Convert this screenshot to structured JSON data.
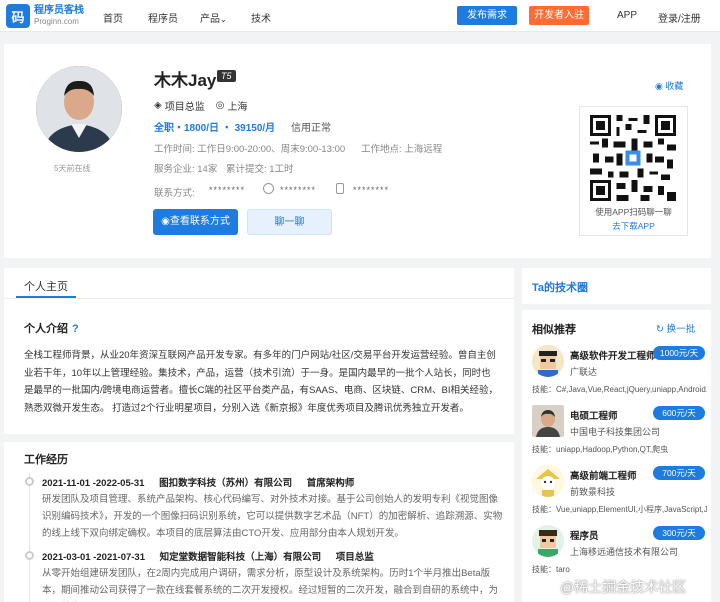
{
  "nav": {
    "logo_mark": "码",
    "logo_cn": "程序员客栈",
    "logo_en": "Proginn.com",
    "items": [
      "首页",
      "程序员",
      "产品",
      "技术"
    ],
    "post_button": "发布需求",
    "join_button": "开发者入驻",
    "app": "APP",
    "login": "登录/注册"
  },
  "profile": {
    "name": "木木Jay",
    "badge": "T5",
    "title": "项目总监",
    "city": "上海",
    "rate": "全职・1800/日 ・ 39150/月",
    "credit": "信用正常",
    "avatar_caption": "5天前在线",
    "work_time": "工作时间: 工作日9:00-20:00、周末9:00-13:00",
    "work_place": "工作地点: 上海远程",
    "service": "服务企业: 14家",
    "submits": "累计提交: 1工时",
    "contact_label": "联系方式:",
    "masked1": "********",
    "masked2": "********",
    "masked3": "********",
    "contact_button": "查看联系方式",
    "chat_button": "聊一聊",
    "favorite": "收藏",
    "qr_caption": "使用APP扫码聊一聊",
    "download": "去下载APP"
  },
  "main": {
    "tab": "个人主页",
    "intro_title": "个人介绍",
    "intro_q": "?",
    "intro": "全栈工程师背景，从业20年资深互联网产品开发专家。有多年的门户网站/社区/交易平台开发运营经验。曾自主创业若干年，10年以上管理经验。集技术，产品，运营（技术引流）于一身。是国内最早的一批个人站长，同时也是最早的一批国内/跨境电商运营者。擅长C端的社区平台类产品，有SAAS、电商、区块链、CRM、BI相关经验，熟悉双微开发生态。 打造过2个行业明星项目，分别入选《新京报》年度优秀项目及腾讯优秀独立开发者。",
    "exp_title": "工作经历",
    "jobs": [
      {
        "period": "2021-11-01 -2022-05-31",
        "company": "图扣数字科技（苏州）有限公司",
        "role": "首席架构师",
        "desc": "研发团队及项目管理、系统产品架构、核心代码编写、对外技术对接。基于公司创始人的发明专利《视觉图像识别编码技术》，开发的一个图像扫码识别系统，它可以提供数字艺术品（NFT）的加密解析、追踪溯源、实物的线上线下双向绑定确权。本项目的底层算法由CTO开发、应用部分由本人规划开发。"
      },
      {
        "period": "2021-03-01 -2021-07-31",
        "company": "知定堂数据智能科技（上海）有限公司",
        "role": "项目总监",
        "desc": "从零开始组建研发团队，在2周内完成用户调研，需求分析，原型设计及系统架构。历时1个半月推出Beta版本，期间推动公司获得了一款在线套餐系统的二次开发授权。经过短暂的二次开发，融合到自研的系统中，为项目节约了"
      }
    ]
  },
  "side": {
    "circle_title": "Ta的技术圈",
    "rec_title": "相似推荐",
    "refresh": "换一批",
    "recs": [
      {
        "name": "高级软件开发工程师",
        "price": "1000元/天",
        "company": "广联达",
        "skills": "技能：C#,Java,Vue,React,jQuery,uniapp,Android..."
      },
      {
        "name": "电硕工程师",
        "price": "600元/天",
        "company": "中国电子科技集团公司",
        "skills": "技能：uniapp,Hadoop,Python,QT,爬虫"
      },
      {
        "name": "高级前端工程师",
        "price": "700元/天",
        "company": "前致景科技",
        "skills": "技能：Vue,uniapp,ElementUI,小程序,JavaScript,J..."
      },
      {
        "name": "程序员",
        "price": "300元/天",
        "company": "上海移远通信技术有限公司",
        "skills": "技能：taro"
      }
    ]
  },
  "watermark": "@稀土掘金技术社区"
}
